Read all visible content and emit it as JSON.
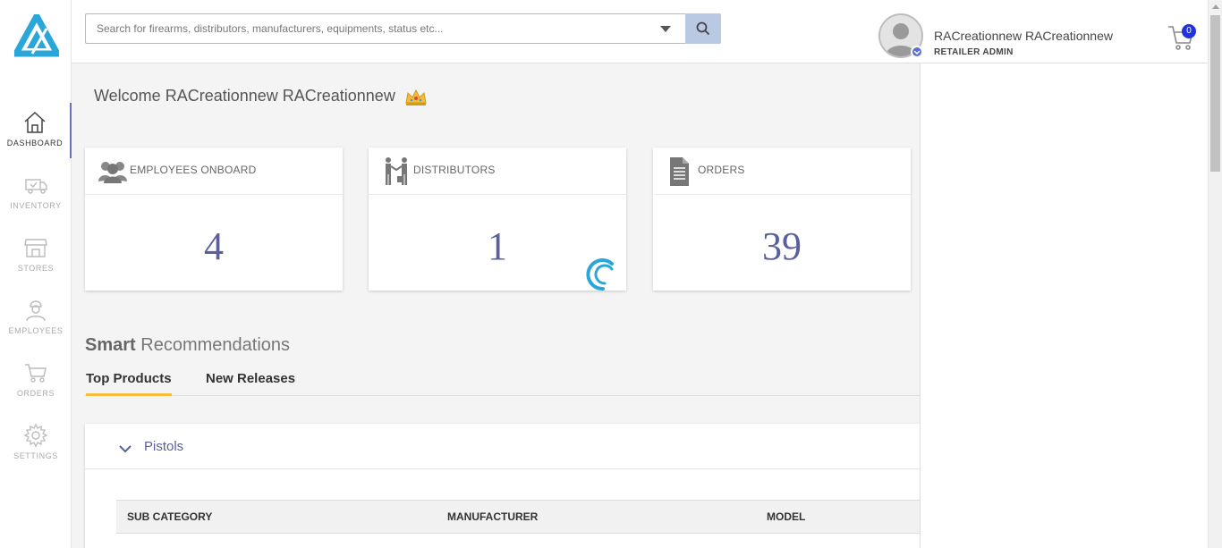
{
  "app": {
    "logo_icon": "brand-triangle-logo",
    "accent_color": "#2aa6d8"
  },
  "sidebar": {
    "items": [
      {
        "label": "DASHBOARD",
        "icon": "home-icon",
        "active": true
      },
      {
        "label": "INVENTORY",
        "icon": "truck-icon",
        "active": false
      },
      {
        "label": "STORES",
        "icon": "store-icon",
        "active": false
      },
      {
        "label": "EMPLOYEES",
        "icon": "employee-icon",
        "active": false
      },
      {
        "label": "ORDERS",
        "icon": "cart-icon",
        "active": false
      },
      {
        "label": "SETTINGS",
        "icon": "gear-icon",
        "active": false
      }
    ]
  },
  "header": {
    "search_placeholder": "Search for firearms, distributors, manufacturers, equipments, status etc...",
    "user_name": "RACreationnew RACreationnew",
    "user_role": "RETAILER ADMIN",
    "cart_count": "0"
  },
  "welcome": {
    "text": "Welcome RACreationnew RACreationnew",
    "emoji": "crown-icon"
  },
  "stats": [
    {
      "title": "EMPLOYEES ONBOARD",
      "value": "4",
      "icon": "users-icon"
    },
    {
      "title": "DISTRIBUTORS",
      "value": "1",
      "icon": "handshake-icon"
    },
    {
      "title": "ORDERS",
      "value": "39",
      "icon": "document-icon"
    }
  ],
  "recommendations": {
    "title_bold": "Smart",
    "title_rest": " Recommendations",
    "tabs": [
      {
        "label": "Top Products",
        "active": true
      },
      {
        "label": "New Releases",
        "active": false
      }
    ],
    "panel": {
      "title": "Pistols",
      "columns": [
        "SUB CATEGORY",
        "MANUFACTURER",
        "MODEL"
      ]
    }
  }
}
